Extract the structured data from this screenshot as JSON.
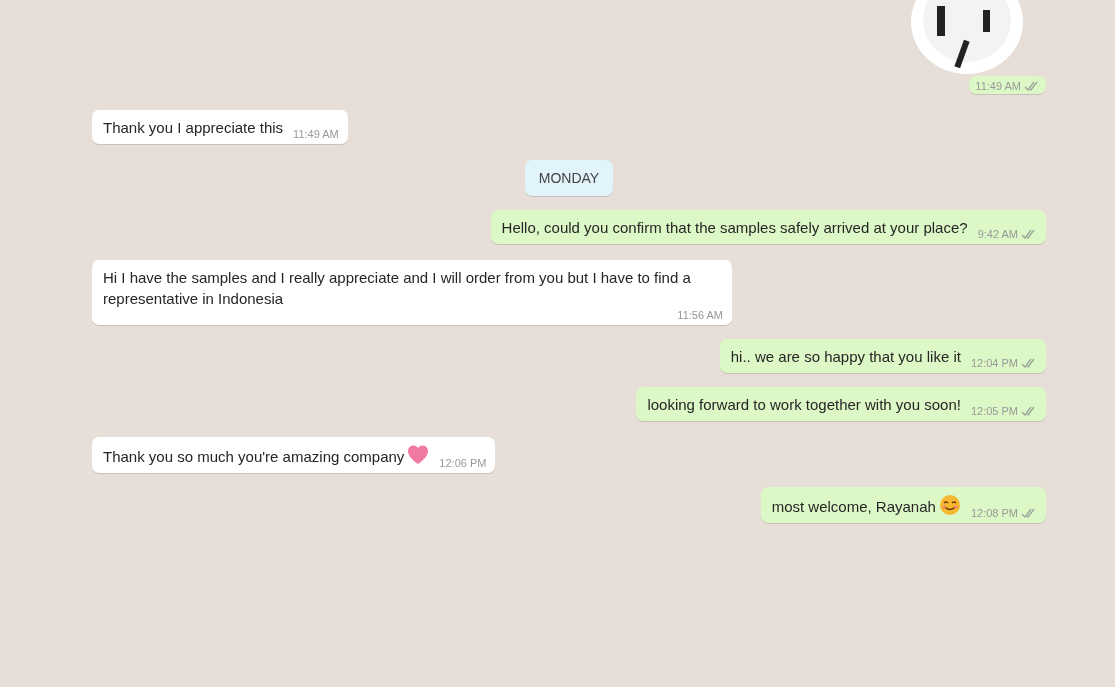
{
  "messages": [
    {
      "kind": "sticker",
      "time": "11:49 AM",
      "read": false
    },
    {
      "kind": "incoming",
      "text": "Thank you I appreciate this",
      "time": "11:49 AM"
    },
    {
      "kind": "date",
      "text": "MONDAY"
    },
    {
      "kind": "outgoing",
      "text": "Hello, could you confirm that the samples safely arrived at your place?",
      "time": "9:42 AM",
      "read": false
    },
    {
      "kind": "incoming",
      "text": "Hi I have the samples and I really appreciate and I will order from you but I have to find a representative in Indonesia",
      "time": "11:56 AM"
    },
    {
      "kind": "outgoing",
      "text": "hi.. we are so happy that you like it",
      "time": "12:04 PM",
      "read": false
    },
    {
      "kind": "outgoing",
      "text": "looking forward to work together with you soon!",
      "time": "12:05 PM",
      "read": false
    },
    {
      "kind": "incoming",
      "text": "Thank you so much you're amazing company",
      "heart_emoji": true,
      "time": "12:06 PM"
    },
    {
      "kind": "outgoing",
      "text": "most welcome, Rayanah",
      "smile_emoji": true,
      "time": "12:08 PM",
      "read": false
    }
  ]
}
